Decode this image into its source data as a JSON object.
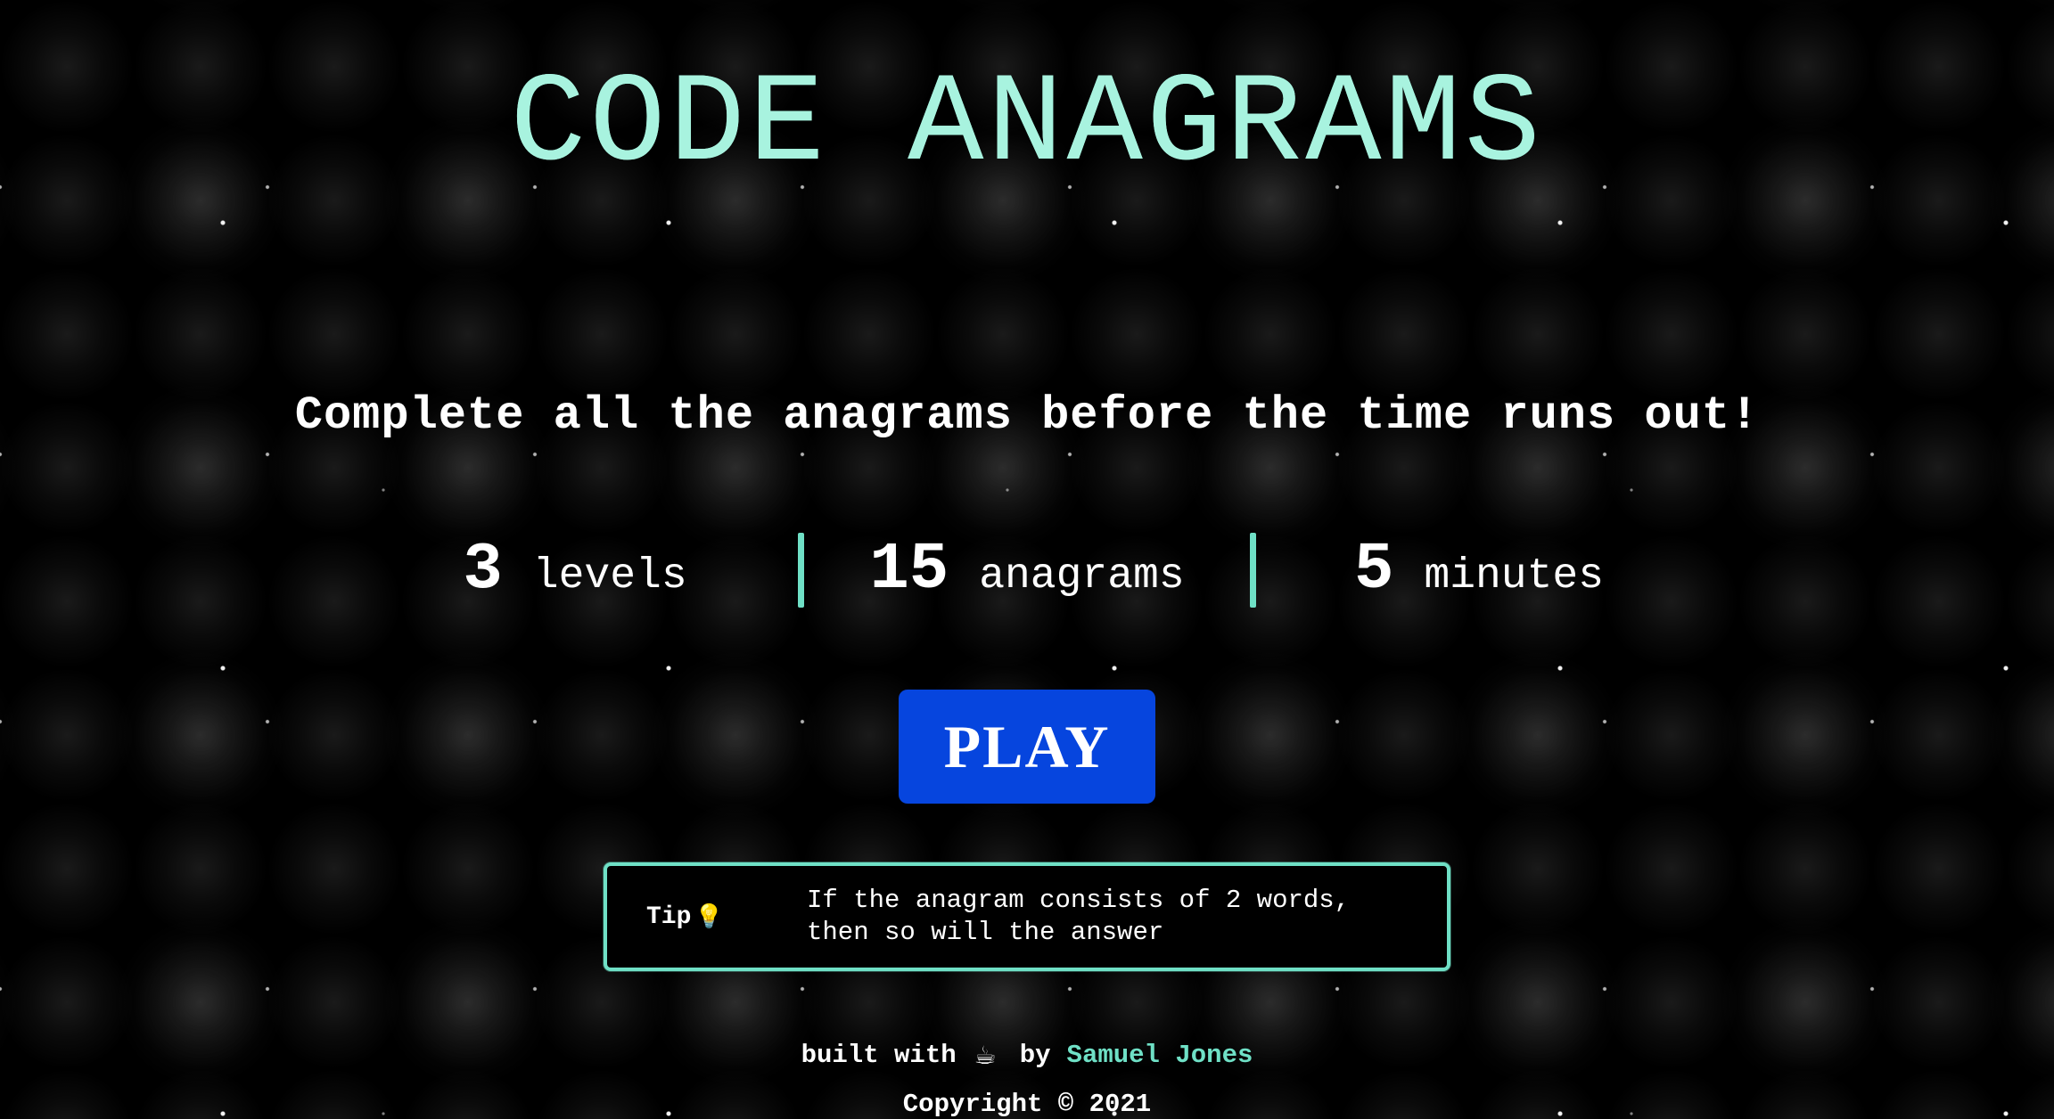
{
  "title": "CODE ANAGRAMS",
  "subtitle": "Complete all the anagrams before the time runs out!",
  "stats": [
    {
      "value": "3",
      "label": "levels"
    },
    {
      "value": "15",
      "label": "anagrams"
    },
    {
      "value": "5",
      "label": "minutes"
    }
  ],
  "play_label": "PLAY",
  "tip": {
    "label": "Tip",
    "icon": "lightbulb-icon",
    "text": "If the anagram consists of 2 words,\nthen so will the answer"
  },
  "footer": {
    "built_with": "built with",
    "icon": "coffee-icon",
    "by": "by",
    "author": "Samuel Jones",
    "copyright": "Copyright © 2021"
  },
  "colors": {
    "accent": "#6fe0c6",
    "button": "#0645de",
    "background": "#000000"
  }
}
